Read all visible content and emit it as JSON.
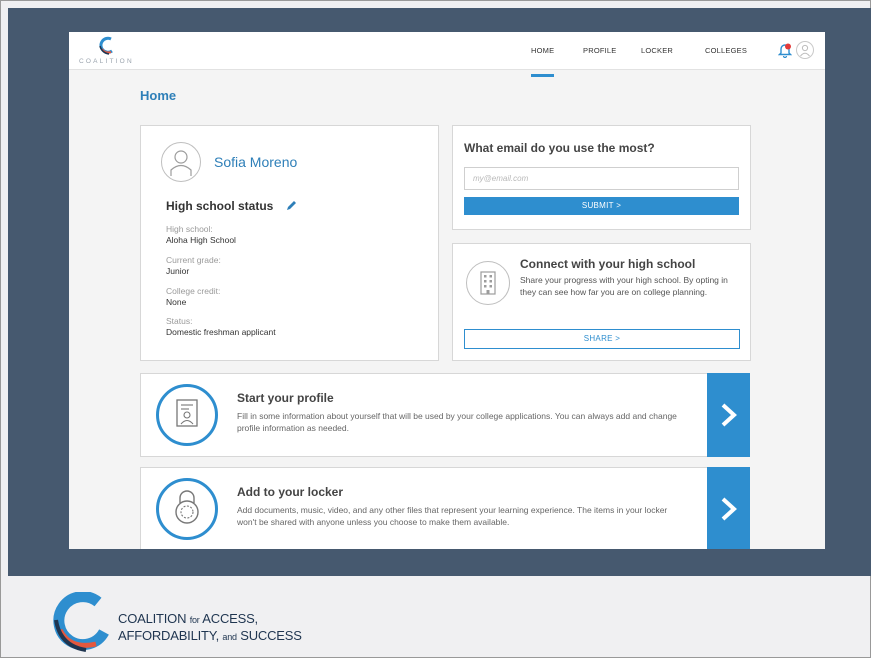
{
  "brand": {
    "name": "COALITION",
    "icon": "coalition-swirl-icon"
  },
  "nav": {
    "items": [
      {
        "label": "HOME",
        "active": true
      },
      {
        "label": "PROFILE",
        "active": false
      },
      {
        "label": "LOCKER",
        "active": false
      },
      {
        "label": "COLLEGES",
        "active": false
      }
    ],
    "notification_icon": "bell-icon",
    "avatar_icon": "user-avatar-icon"
  },
  "page": {
    "title": "Home"
  },
  "student": {
    "name": "Sofia Moreno",
    "status_heading": "High school status",
    "fields": [
      {
        "label": "High school:",
        "value": "Aloha High School"
      },
      {
        "label": "Current grade:",
        "value": "Junior"
      },
      {
        "label": "College credit:",
        "value": "None"
      },
      {
        "label": "Status:",
        "value": "Domestic freshman applicant"
      }
    ]
  },
  "email": {
    "title": "What email do you use the most?",
    "placeholder": "my@email.com",
    "value": "",
    "submit_label": "SUBMIT >"
  },
  "connect": {
    "title": "Connect with your high school",
    "description": "Share your progress with your high school. By opting in they can see how far you are on college planning.",
    "share_label": "SHARE >"
  },
  "tasks": [
    {
      "title": "Start your profile",
      "description": "Fill in some information about yourself that will be used by your college applications. You can always add and change profile information as needed."
    },
    {
      "title": "Add to your locker",
      "description": "Add documents, music, video, and any other files that represent your learning experience. The items in your locker won't be shared with anyone unless you choose to make them available."
    }
  ],
  "footer": {
    "line1": "COALITION",
    "line1_small": "for",
    "line1_end": "ACCESS,",
    "line2": "AFFORDABILITY,",
    "line2_small": "and",
    "line2_end": "SUCCESS"
  },
  "colors": {
    "accent": "#2e8ecf",
    "title_blue": "#2e7fb8",
    "backdrop": "#46596f"
  }
}
